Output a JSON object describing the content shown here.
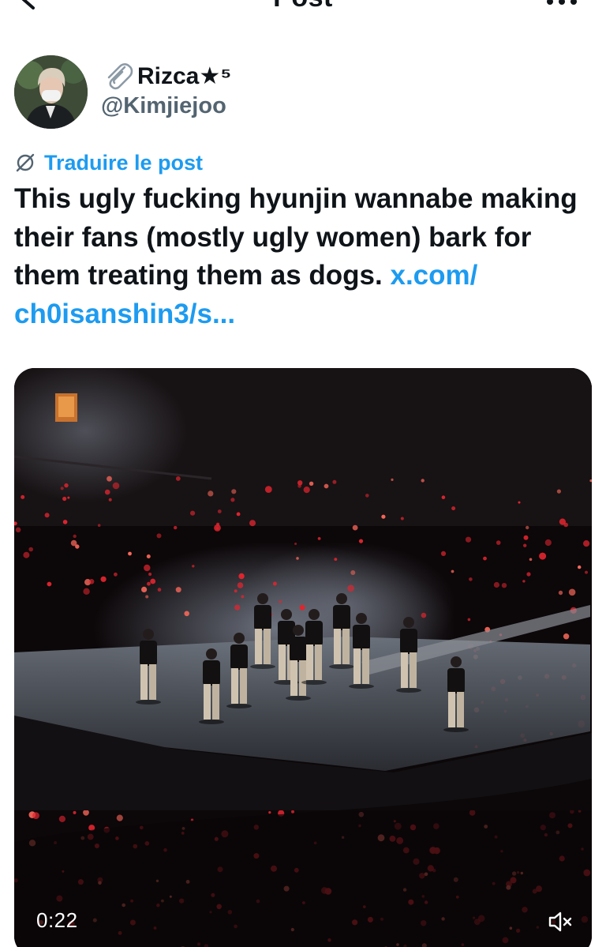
{
  "header": {
    "title": "Post",
    "back_icon": "arrow-left-icon",
    "more_icon": "more-horizontal-icon"
  },
  "author": {
    "display_name": "Rizca★⁵",
    "handle": "@Kimjiejoo",
    "prefix_icon": "paperclip-icon"
  },
  "translate": {
    "label": "Traduire le post",
    "icon": "translate-icon"
  },
  "post": {
    "text": "This ugly fucking hyunjin wannabe making their fans (mostly ugly women) bark for them treating them as dogs.",
    "link_text": "x.com/ ch0isanshin3/s..."
  },
  "media": {
    "type": "video",
    "time": "0:22",
    "mute_icon": "speaker-muted-icon"
  },
  "colors": {
    "accent": "#1d9bf0",
    "text": "#0f1419",
    "secondary": "#536471"
  }
}
